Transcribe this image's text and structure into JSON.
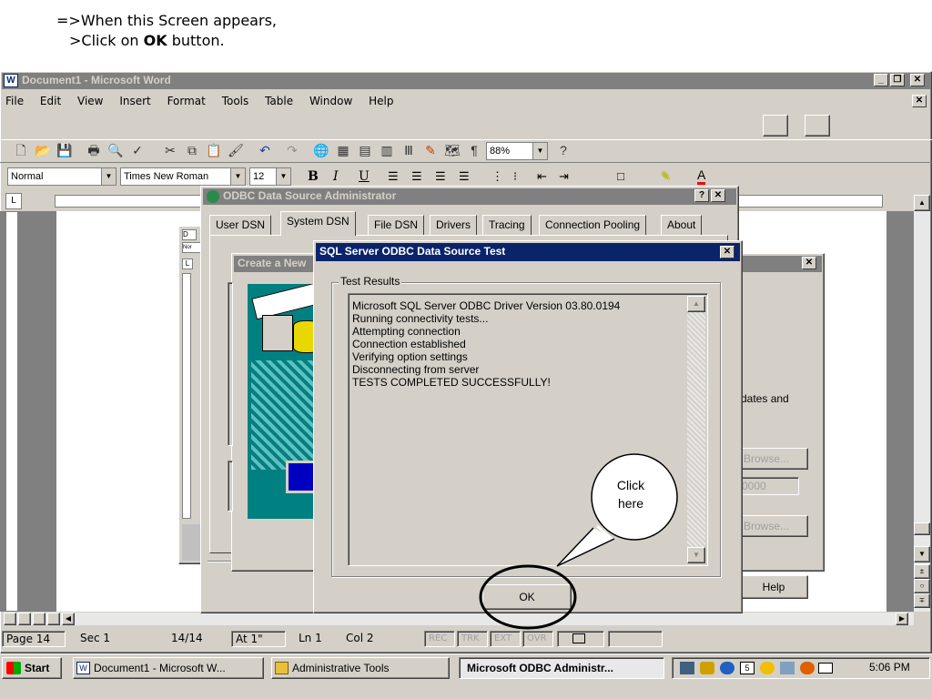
{
  "instruction": {
    "line1": "=>When this Screen appears,",
    "line2_prefix": ">Click on ",
    "line2_bold": "OK",
    "line2_suffix": " button."
  },
  "word": {
    "title": "Document1 - Microsoft Word",
    "menu": [
      "File",
      "Edit",
      "View",
      "Insert",
      "Format",
      "Tools",
      "Table",
      "Window",
      "Help"
    ],
    "zoom": "88%",
    "style": "Normal",
    "font": "Times New Roman",
    "font_size": "12",
    "status": {
      "page": "Page 14",
      "sec": "Sec 1",
      "pages": "14/14",
      "at": "At 1\"",
      "ln": "Ln 1",
      "col": "Col 2",
      "rec": "REC",
      "trk": "TRK",
      "ext": "EXT",
      "ovr": "OVR"
    }
  },
  "odbc_admin": {
    "title": "ODBC Data Source Administrator",
    "tabs": [
      "User DSN",
      "System DSN",
      "File DSN",
      "Drivers",
      "Tracing",
      "Connection Pooling",
      "About"
    ],
    "partial_text": "dates and",
    "browse1": "Browse...",
    "browse2": "Browse...",
    "field_value": "0000",
    "help_label": "Help"
  },
  "create_new": {
    "title": "Create a New"
  },
  "sql_test": {
    "title": "SQL Server ODBC Data Source Test",
    "group_label": "Test Results",
    "lines": [
      "Microsoft SQL Server ODBC Driver Version 03.80.0194",
      "",
      "Running connectivity tests...",
      "",
      "Attempting connection",
      "Connection established",
      "Verifying option settings",
      "Disconnecting from server",
      "",
      "TESTS COMPLETED SUCCESSFULLY!"
    ],
    "ok_label": "OK"
  },
  "callout": {
    "text_line1": "Click",
    "text_line2": "here"
  },
  "taskbar": {
    "start": "Start",
    "tasks": [
      "Document1 - Microsoft W...",
      "Administrative Tools",
      "Microsoft ODBC Administr..."
    ],
    "time": "5:06 PM"
  },
  "colors": {
    "face": "#d4d0c8",
    "active_title": "#0a246a",
    "inactive_title": "#808080"
  }
}
